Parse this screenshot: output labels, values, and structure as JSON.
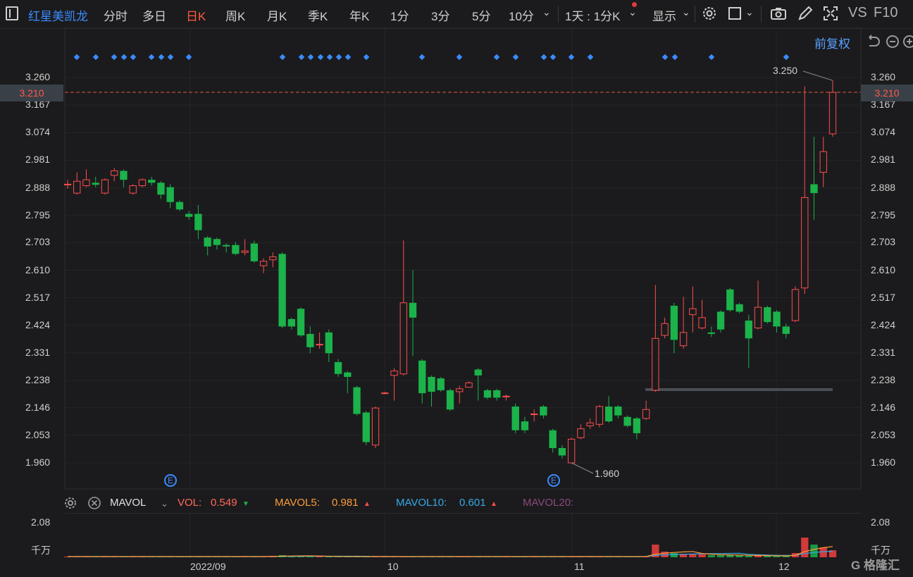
{
  "toolbar": {
    "stock_name": "红星美凯龙",
    "periods": [
      "分时",
      "多日",
      "日K",
      "周K",
      "月K",
      "季K",
      "年K",
      "1分",
      "3分",
      "5分",
      "10分"
    ],
    "active_period": "日K",
    "period_select": "1天 : 1分K",
    "display_label": "显示",
    "vs_label": "VS",
    "f10_label": "F10",
    "adjust_label": "前复权"
  },
  "price_axis": {
    "ticks": [
      "3.260",
      "3.167",
      "3.074",
      "2.981",
      "2.888",
      "2.795",
      "2.703",
      "2.610",
      "2.517",
      "2.424",
      "2.331",
      "2.238",
      "2.146",
      "2.053",
      "1.960"
    ],
    "current": "3.210",
    "high_annotation": "3.250",
    "low_annotation": "1.960",
    "event_marker": "E"
  },
  "volume": {
    "indicator": "MAVOL",
    "vol_label": "VOL:",
    "vol_value": "0.549",
    "ma5_label": "MAVOL5:",
    "ma5_value": "0.981",
    "ma10_label": "MAVOL10:",
    "ma10_value": "0.601",
    "ma20_label": "MAVOL20:",
    "axis_max": "2.08",
    "unit": "千万"
  },
  "x_labels": [
    "2022/09",
    "10",
    "11",
    "12"
  ],
  "watermark": "G 格隆汇",
  "colors": {
    "up": "#ff4d4d",
    "down": "#1bb34a",
    "accent": "#3b8cff",
    "bg": "#1b1b1d"
  },
  "chart_data": {
    "type": "candlestick",
    "ylim": [
      1.92,
      3.28
    ],
    "candles": [
      {
        "o": 2.9,
        "c": 2.9,
        "h": 2.915,
        "l": 2.885
      },
      {
        "o": 2.87,
        "c": 2.91,
        "h": 2.94,
        "l": 2.865
      },
      {
        "o": 2.895,
        "c": 2.915,
        "h": 2.95,
        "l": 2.89
      },
      {
        "o": 2.905,
        "c": 2.898,
        "h": 2.925,
        "l": 2.89
      },
      {
        "o": 2.87,
        "c": 2.915,
        "h": 2.92,
        "l": 2.865
      },
      {
        "o": 2.93,
        "c": 2.945,
        "h": 2.955,
        "l": 2.91
      },
      {
        "o": 2.945,
        "c": 2.915,
        "h": 2.95,
        "l": 2.89
      },
      {
        "o": 2.87,
        "c": 2.895,
        "h": 2.9,
        "l": 2.865
      },
      {
        "o": 2.895,
        "c": 2.915,
        "h": 2.92,
        "l": 2.89
      },
      {
        "o": 2.915,
        "c": 2.905,
        "h": 2.925,
        "l": 2.895
      },
      {
        "o": 2.905,
        "c": 2.865,
        "h": 2.91,
        "l": 2.85
      },
      {
        "o": 2.89,
        "c": 2.84,
        "h": 2.9,
        "l": 2.82
      },
      {
        "o": 2.84,
        "c": 2.815,
        "h": 2.845,
        "l": 2.81
      },
      {
        "o": 2.8,
        "c": 2.79,
        "h": 2.81,
        "l": 2.78
      },
      {
        "o": 2.8,
        "c": 2.745,
        "h": 2.83,
        "l": 2.715
      },
      {
        "o": 2.72,
        "c": 2.69,
        "h": 2.725,
        "l": 2.66
      },
      {
        "o": 2.715,
        "c": 2.695,
        "h": 2.72,
        "l": 2.68
      },
      {
        "o": 2.695,
        "c": 2.69,
        "h": 2.7,
        "l": 2.67
      },
      {
        "o": 2.695,
        "c": 2.665,
        "h": 2.705,
        "l": 2.66
      },
      {
        "o": 2.67,
        "c": 2.675,
        "h": 2.715,
        "l": 2.66
      },
      {
        "o": 2.7,
        "c": 2.64,
        "h": 2.71,
        "l": 2.635
      },
      {
        "o": 2.625,
        "c": 2.64,
        "h": 2.65,
        "l": 2.6
      },
      {
        "o": 2.645,
        "c": 2.655,
        "h": 2.67,
        "l": 2.62
      },
      {
        "o": 2.665,
        "c": 2.42,
        "h": 2.67,
        "l": 2.415
      },
      {
        "o": 2.445,
        "c": 2.42,
        "h": 2.45,
        "l": 2.41
      },
      {
        "o": 2.48,
        "c": 2.39,
        "h": 2.485,
        "l": 2.385
      },
      {
        "o": 2.395,
        "c": 2.35,
        "h": 2.42,
        "l": 2.33
      },
      {
        "o": 2.36,
        "c": 2.36,
        "h": 2.4,
        "l": 2.345
      },
      {
        "o": 2.4,
        "c": 2.33,
        "h": 2.41,
        "l": 2.3
      },
      {
        "o": 2.3,
        "c": 2.26,
        "h": 2.31,
        "l": 2.25
      },
      {
        "o": 2.265,
        "c": 2.25,
        "h": 2.27,
        "l": 2.195
      },
      {
        "o": 2.215,
        "c": 2.125,
        "h": 2.22,
        "l": 2.12
      },
      {
        "o": 2.13,
        "c": 2.03,
        "h": 2.135,
        "l": 2.02
      },
      {
        "o": 2.02,
        "c": 2.145,
        "h": 2.15,
        "l": 2.01
      },
      {
        "o": 2.196,
        "c": 2.196,
        "h": 2.2,
        "l": 2.192
      },
      {
        "o": 2.255,
        "c": 2.27,
        "h": 2.28,
        "l": 2.17
      },
      {
        "o": 2.26,
        "c": 2.5,
        "h": 2.71,
        "l": 2.255
      },
      {
        "o": 2.5,
        "c": 2.45,
        "h": 2.61,
        "l": 2.32
      },
      {
        "o": 2.305,
        "c": 2.195,
        "h": 2.31,
        "l": 2.16
      },
      {
        "o": 2.25,
        "c": 2.2,
        "h": 2.255,
        "l": 2.15
      },
      {
        "o": 2.245,
        "c": 2.205,
        "h": 2.25,
        "l": 2.2
      },
      {
        "o": 2.205,
        "c": 2.14,
        "h": 2.21,
        "l": 2.135
      },
      {
        "o": 2.2,
        "c": 2.21,
        "h": 2.22,
        "l": 2.16
      },
      {
        "o": 2.215,
        "c": 2.23,
        "h": 2.235,
        "l": 2.215
      },
      {
        "o": 2.275,
        "c": 2.255,
        "h": 2.28,
        "l": 2.17
      },
      {
        "o": 2.205,
        "c": 2.18,
        "h": 2.21,
        "l": 2.175
      },
      {
        "o": 2.205,
        "c": 2.18,
        "h": 2.21,
        "l": 2.17
      },
      {
        "o": 2.185,
        "c": 2.185,
        "h": 2.19,
        "l": 2.17
      },
      {
        "o": 2.15,
        "c": 2.07,
        "h": 2.16,
        "l": 2.06
      },
      {
        "o": 2.1,
        "c": 2.07,
        "h": 2.115,
        "l": 2.06
      },
      {
        "o": 2.125,
        "c": 2.125,
        "h": 2.14,
        "l": 2.1
      },
      {
        "o": 2.15,
        "c": 2.12,
        "h": 2.155,
        "l": 2.11
      },
      {
        "o": 2.07,
        "c": 2.01,
        "h": 2.075,
        "l": 1.995
      },
      {
        "o": 2.01,
        "c": 1.985,
        "h": 2.02,
        "l": 1.975
      },
      {
        "o": 1.96,
        "c": 2.04,
        "h": 2.045,
        "l": 1.96
      },
      {
        "o": 2.045,
        "c": 2.075,
        "h": 2.09,
        "l": 2.04
      },
      {
        "o": 2.085,
        "c": 2.095,
        "h": 2.11,
        "l": 2.075
      },
      {
        "o": 2.09,
        "c": 2.15,
        "h": 2.155,
        "l": 2.08
      },
      {
        "o": 2.15,
        "c": 2.1,
        "h": 2.185,
        "l": 2.095
      },
      {
        "o": 2.15,
        "c": 2.12,
        "h": 2.155,
        "l": 2.11
      },
      {
        "o": 2.115,
        "c": 2.085,
        "h": 2.12,
        "l": 2.08
      },
      {
        "o": 2.11,
        "c": 2.06,
        "h": 2.115,
        "l": 2.04
      },
      {
        "o": 2.11,
        "c": 2.14,
        "h": 2.17,
        "l": 2.105
      },
      {
        "o": 2.205,
        "c": 2.38,
        "h": 2.56,
        "l": 2.2
      },
      {
        "o": 2.39,
        "c": 2.43,
        "h": 2.45,
        "l": 2.38
      },
      {
        "o": 2.49,
        "c": 2.375,
        "h": 2.5,
        "l": 2.33
      },
      {
        "o": 2.355,
        "c": 2.4,
        "h": 2.52,
        "l": 2.345
      },
      {
        "o": 2.46,
        "c": 2.48,
        "h": 2.555,
        "l": 2.4
      },
      {
        "o": 2.415,
        "c": 2.45,
        "h": 2.51,
        "l": 2.41
      },
      {
        "o": 2.4,
        "c": 2.395,
        "h": 2.42,
        "l": 2.385
      },
      {
        "o": 2.47,
        "c": 2.41,
        "h": 2.475,
        "l": 2.4
      },
      {
        "o": 2.545,
        "c": 2.475,
        "h": 2.55,
        "l": 2.47
      },
      {
        "o": 2.495,
        "c": 2.47,
        "h": 2.5,
        "l": 2.465
      },
      {
        "o": 2.44,
        "c": 2.38,
        "h": 2.46,
        "l": 2.28
      },
      {
        "o": 2.415,
        "c": 2.485,
        "h": 2.575,
        "l": 2.41
      },
      {
        "o": 2.485,
        "c": 2.435,
        "h": 2.49,
        "l": 2.43
      },
      {
        "o": 2.47,
        "c": 2.42,
        "h": 2.475,
        "l": 2.4
      },
      {
        "o": 2.42,
        "c": 2.395,
        "h": 2.43,
        "l": 2.38
      },
      {
        "o": 2.44,
        "c": 2.545,
        "h": 2.555,
        "l": 2.435
      },
      {
        "o": 2.55,
        "c": 2.855,
        "h": 3.23,
        "l": 2.53
      },
      {
        "o": 2.9,
        "c": 2.87,
        "h": 3.06,
        "l": 2.78
      },
      {
        "o": 2.94,
        "c": 3.01,
        "h": 3.06,
        "l": 2.89
      },
      {
        "o": 3.07,
        "c": 3.21,
        "h": 3.25,
        "l": 3.06
      }
    ],
    "volume": [
      1,
      1,
      1,
      1,
      1,
      1,
      1,
      1,
      1,
      1,
      1,
      1,
      1,
      1,
      1,
      1,
      1,
      1,
      1,
      1,
      1,
      1,
      2,
      3,
      2,
      2,
      1,
      1,
      1,
      1,
      1,
      1,
      1,
      1,
      1,
      1,
      1,
      1,
      1,
      1,
      1,
      1,
      1,
      1,
      1,
      1,
      1,
      1,
      1,
      1,
      1,
      1,
      1,
      1,
      1,
      1,
      1,
      1,
      1,
      1,
      1,
      1,
      1,
      18,
      8,
      6,
      5,
      4,
      4,
      3,
      3,
      3,
      3,
      2,
      2,
      2,
      2,
      2,
      6,
      28,
      18,
      14,
      10
    ]
  }
}
